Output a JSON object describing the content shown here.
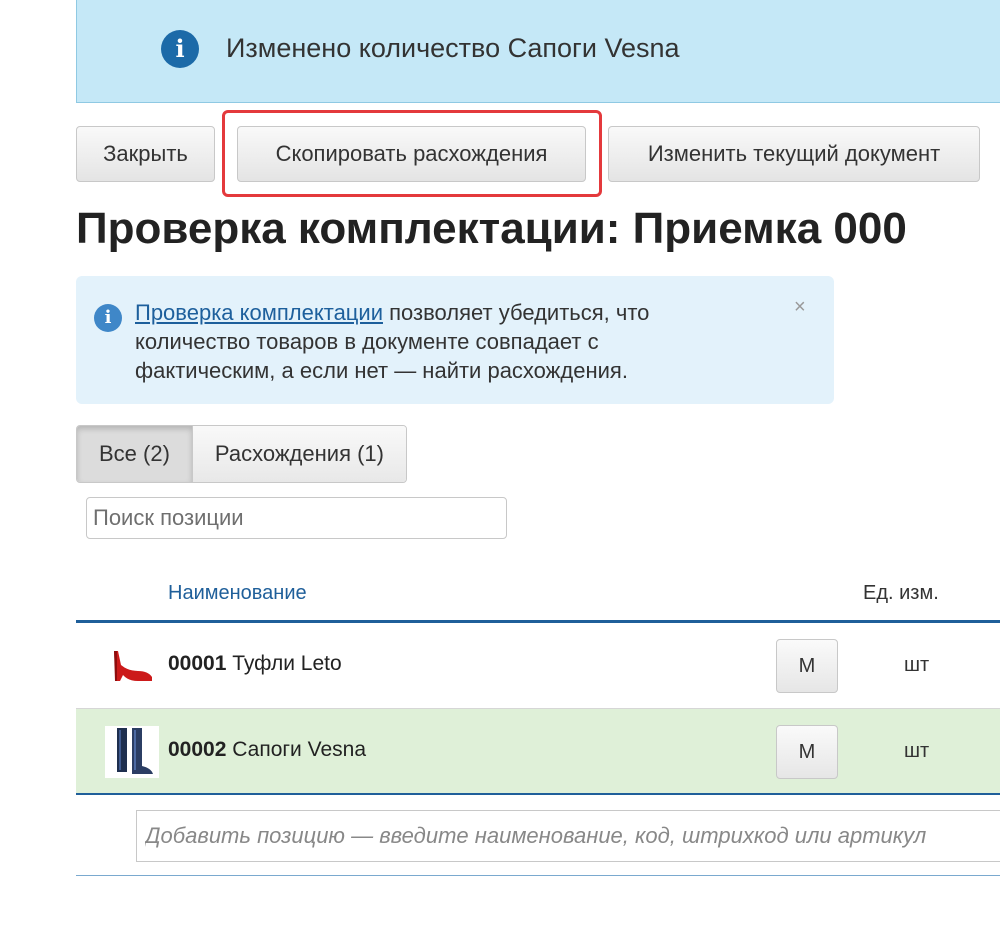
{
  "notification": {
    "icon": "info-icon",
    "text": "Изменено количество Сапоги Vesna"
  },
  "toolbar": {
    "close_label": "Закрыть",
    "copy_diff_label": "Скопировать расхождения",
    "edit_doc_label": "Изменить текущий документ"
  },
  "page": {
    "title": "Проверка комплектации: Приемка 000"
  },
  "info": {
    "icon": "info-icon",
    "link_text": "Проверка комплектации",
    "text": " позволяет убедиться, что количество товаров в документе совпадает с фактическим, а если нет — найти расхождения.",
    "close_icon": "×"
  },
  "tabs": [
    {
      "label": "Все (2)",
      "active": true
    },
    {
      "label": "Расхождения (1)",
      "active": false
    }
  ],
  "search": {
    "placeholder": "Поиск позиции"
  },
  "table": {
    "columns": {
      "name": "Наименование",
      "unit": "Ед. изм."
    },
    "rows": [
      {
        "code": "00001",
        "name": "Туфли Leto",
        "m_label": "М",
        "unit": "шт",
        "icon": "red-shoe-icon",
        "highlight": false
      },
      {
        "code": "00002",
        "name": "Сапоги Vesna",
        "m_label": "М",
        "unit": "шт",
        "icon": "boots-icon",
        "highlight": true
      }
    ]
  },
  "add_position": {
    "placeholder": "Добавить позицию — введите наименование, код, штрихкод или артикул"
  },
  "colors": {
    "notice_bg": "#c5e8f7",
    "info_bg": "#e3f2fb",
    "highlight_row": "#dff0d8",
    "accent_blue": "#1f5f9a",
    "annotation_red": "#e4393c"
  }
}
